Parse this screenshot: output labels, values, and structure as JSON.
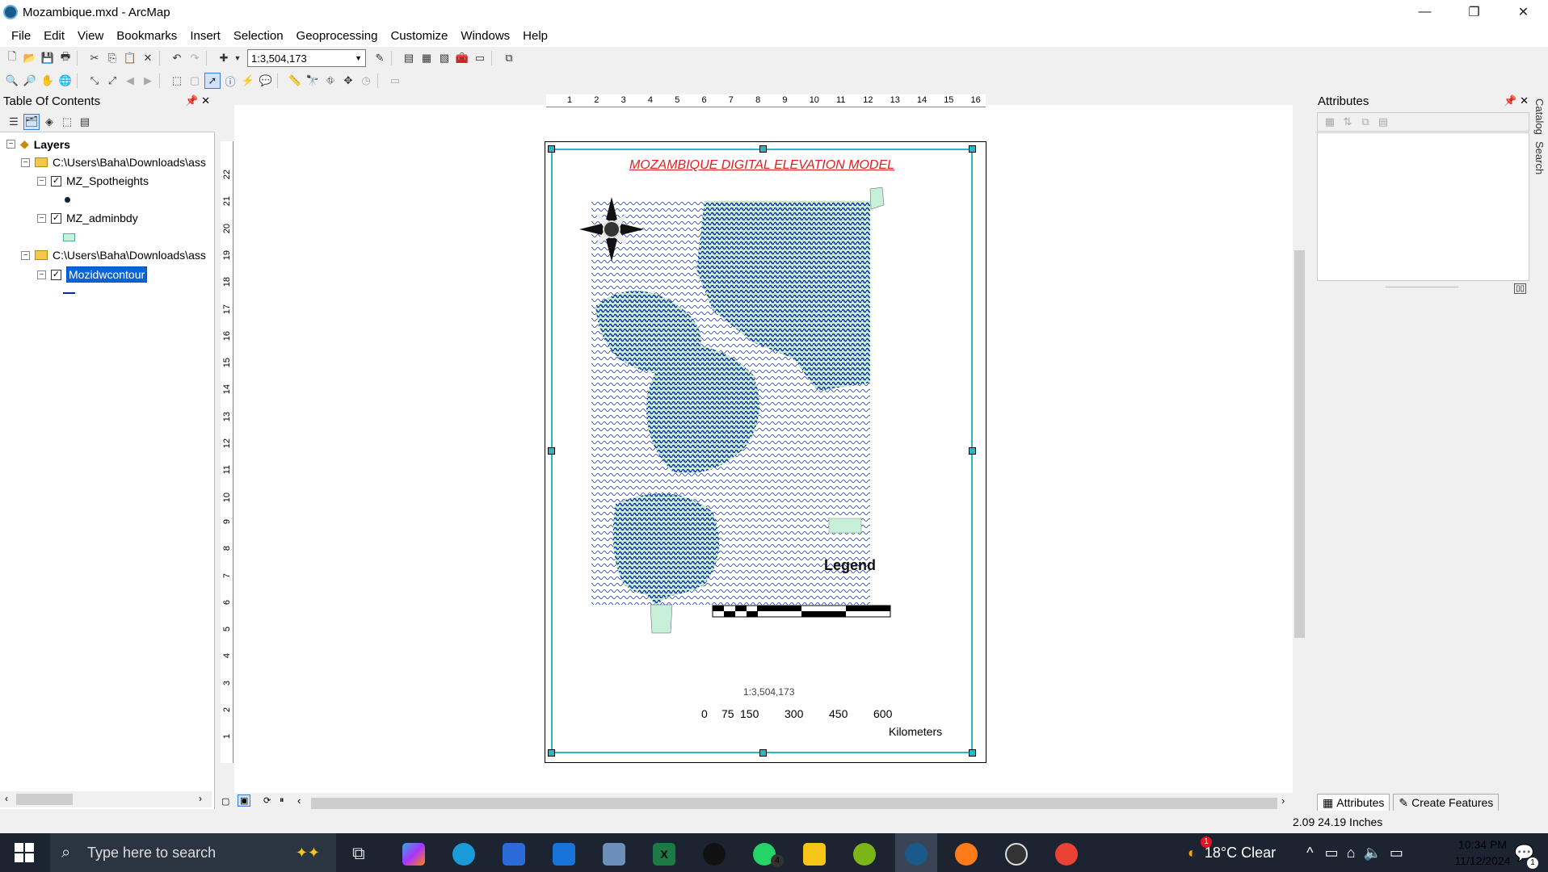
{
  "window": {
    "title": "Mozambique.mxd - ArcMap",
    "minimize": "—",
    "restore": "❐",
    "close": "✕"
  },
  "menu": [
    "File",
    "Edit",
    "View",
    "Bookmarks",
    "Insert",
    "Selection",
    "Geoprocessing",
    "Customize",
    "Windows",
    "Help"
  ],
  "toolbar": {
    "scale_value": "1:3,504,173"
  },
  "toc": {
    "title": "Table Of Contents",
    "root": "Layers",
    "items": [
      {
        "label": "C:\\Users\\Baha\\Downloads\\ass",
        "type": "folder"
      },
      {
        "label": "MZ_Spotheights",
        "type": "layer",
        "checked": true
      },
      {
        "label": "MZ_adminbdy",
        "type": "layer",
        "checked": true
      },
      {
        "label": "C:\\Users\\Baha\\Downloads\\ass",
        "type": "folder"
      },
      {
        "label": "Mozidwcontour",
        "type": "layer",
        "checked": true,
        "selected": true
      }
    ]
  },
  "ruler_top": [
    "1",
    "2",
    "3",
    "4",
    "5",
    "6",
    "7",
    "8",
    "9",
    "10",
    "11",
    "12",
    "13",
    "14",
    "15",
    "16"
  ],
  "ruler_left": [
    "22",
    "21",
    "20",
    "19",
    "18",
    "17",
    "16",
    "15",
    "14",
    "13",
    "12",
    "11",
    "10",
    "9",
    "8",
    "7",
    "6",
    "5",
    "4",
    "3",
    "2",
    "1"
  ],
  "map": {
    "title": "MOZAMBIQUE DIGITAL ELEVATION MODEL",
    "legend_title": "Legend",
    "scale_text": "1:3,504,173",
    "scale_labels": [
      "0",
      "75",
      "150",
      "300",
      "450",
      "600"
    ],
    "scale_units": "Kilometers",
    "colors": {
      "contour": "#0a2a9c",
      "land": "#c8f0d8",
      "title": "#e02020",
      "frame": "#2bb6c6"
    }
  },
  "attributes": {
    "title": "Attributes",
    "tabs": [
      "Attributes",
      "Create Features"
    ],
    "side_tabs": [
      "Catalog",
      "Search"
    ]
  },
  "status": {
    "coords": "2.09  24.19 Inches"
  },
  "taskbar": {
    "search_placeholder": "Type here to search",
    "weather": "18°C  Clear",
    "time": "10:34 PM",
    "date": "11/12/2024",
    "whatsapp_badge": "4",
    "notif_badge": "1"
  }
}
